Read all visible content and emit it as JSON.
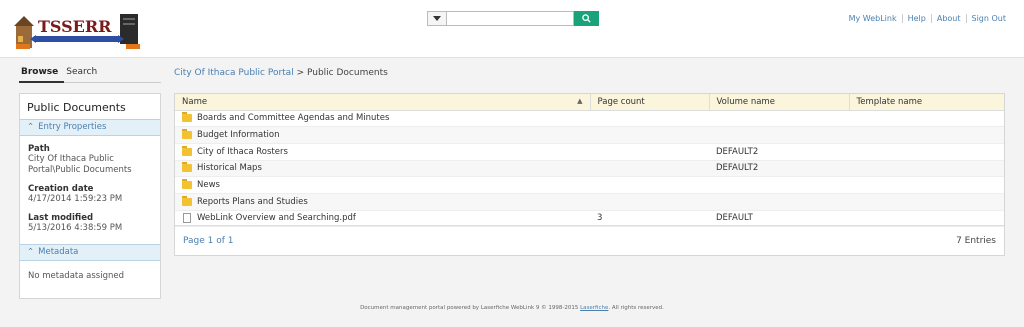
{
  "header": {
    "logo_text": "TSSERR",
    "search": {
      "placeholder": "",
      "value": ""
    },
    "links": [
      "My WebLink",
      "Help",
      "About",
      "Sign Out"
    ]
  },
  "tabs": [
    "Browse",
    "Search"
  ],
  "left_panel": {
    "title": "Public Documents",
    "entry_properties_label": "Entry Properties",
    "path_label": "Path",
    "path_value": "City Of Ithaca Public Portal\\Public Documents",
    "creation_label": "Creation date",
    "creation_value": "4/17/2014 1:59:23 PM",
    "modified_label": "Last modified",
    "modified_value": "5/13/2016 4:38:59 PM",
    "metadata_label": "Metadata",
    "metadata_empty": "No metadata assigned"
  },
  "breadcrumb": {
    "root": "City Of Ithaca Public Portal",
    "separator": ">",
    "current": "Public Documents"
  },
  "table": {
    "columns": [
      "Name",
      "Page count",
      "Volume name",
      "Template name"
    ],
    "rows": [
      {
        "type": "folder",
        "name": "Boards and Committee Agendas and Minutes",
        "pages": "",
        "volume": "",
        "template": ""
      },
      {
        "type": "folder",
        "name": "Budget Information",
        "pages": "",
        "volume": "",
        "template": ""
      },
      {
        "type": "folder",
        "name": "City of Ithaca Rosters",
        "pages": "",
        "volume": "DEFAULT2",
        "template": ""
      },
      {
        "type": "folder",
        "name": "Historical Maps",
        "pages": "",
        "volume": "DEFAULT2",
        "template": ""
      },
      {
        "type": "folder",
        "name": "News",
        "pages": "",
        "volume": "",
        "template": ""
      },
      {
        "type": "folder",
        "name": "Reports Plans and Studies",
        "pages": "",
        "volume": "",
        "template": ""
      },
      {
        "type": "document",
        "name": "WebLink Overview and Searching.pdf",
        "pages": "3",
        "volume": "DEFAULT",
        "template": ""
      }
    ],
    "pager": "Page 1 of 1",
    "entries": "7 Entries"
  },
  "footer": {
    "text_before": "Document management portal powered by Laserfiche WebLink 9 © 1998-2015",
    "link": "Laserfiche",
    "text_after": ". All rights reserved."
  },
  "colors": {
    "accent": "#4a7fb0",
    "search_button": "#1aa37a",
    "header_row": "#fbf5dc",
    "section_bg": "#e4f0f7"
  }
}
